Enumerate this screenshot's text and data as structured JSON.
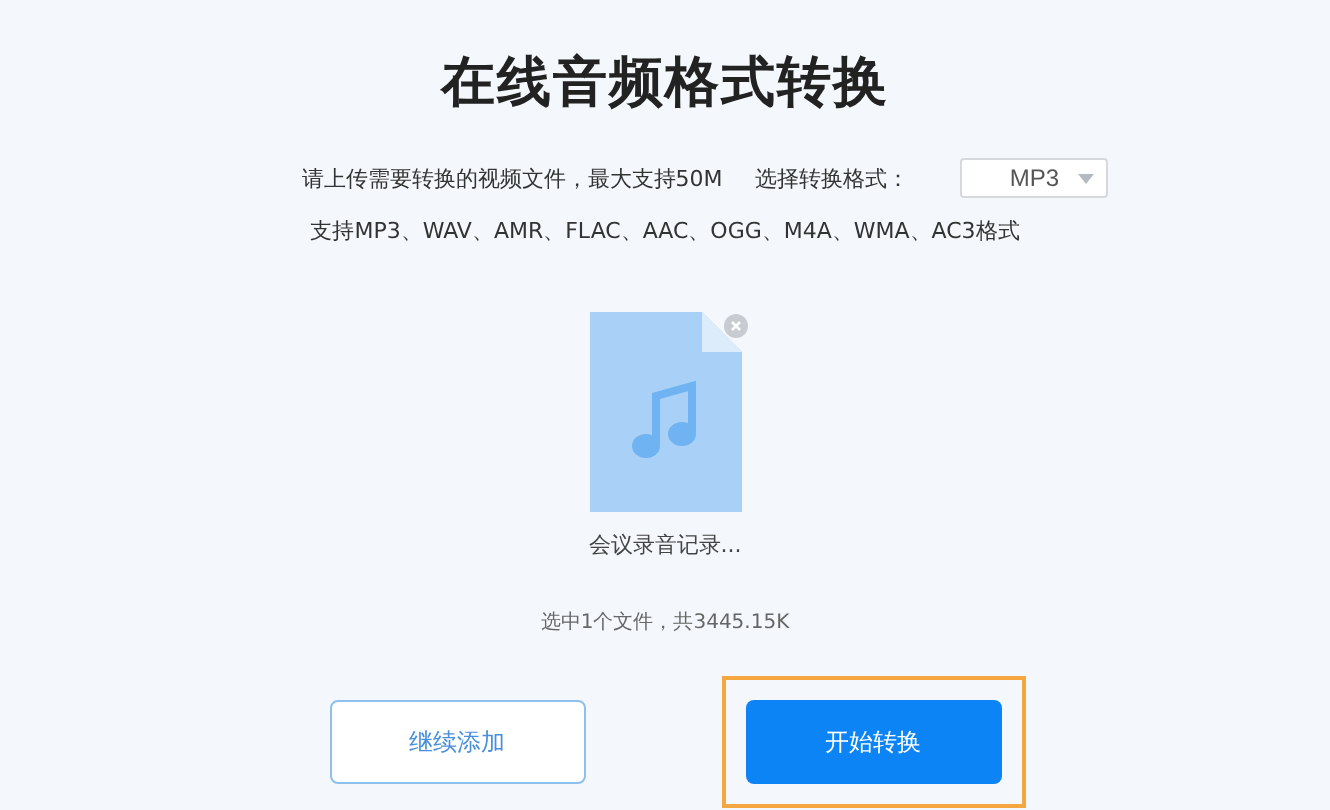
{
  "title": "在线音频格式转换",
  "upload_hint": "请上传需要转换的视频文件，最大支持50M",
  "format_select": {
    "label": "选择转换格式：",
    "value": "MP3"
  },
  "supported_formats": "支持MP3、WAV、AMR、FLAC、AAC、OGG、M4A、WMA、AC3格式",
  "file": {
    "name": "会议录音记录..."
  },
  "selection_summary": "选中1个文件，共3445.15K",
  "buttons": [
    {
      "label": "继续添加",
      "kind": "secondary",
      "highlighted": false
    },
    {
      "label": "开始转换",
      "kind": "primary",
      "highlighted": true
    }
  ]
}
